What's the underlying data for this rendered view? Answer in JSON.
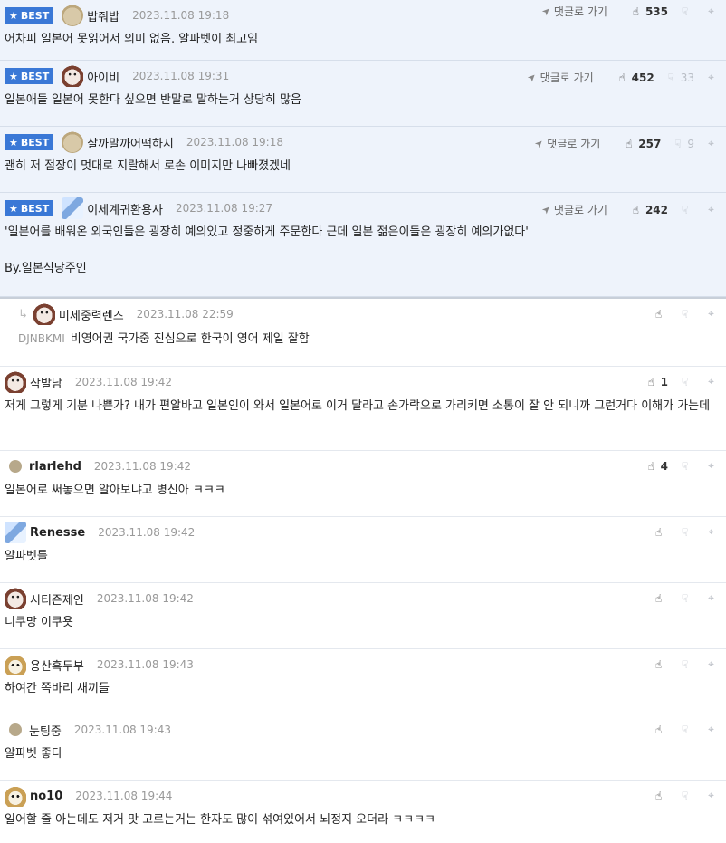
{
  "ui": {
    "best_label": "BEST",
    "goto_label": "댓글로 가기"
  },
  "comments": [
    {
      "best": true,
      "avatar": "blob-avatar",
      "nickname": "밥줘밥",
      "date": "2023.11.08 19:18",
      "likes": "535",
      "dislikes": "",
      "show_goto": true,
      "body": "어차피 일본어 못읽어서 의미 없음. 알파벳이 최고임"
    },
    {
      "best": true,
      "avatar": "dog-avatar",
      "nickname": "아이비",
      "date": "2023.11.08 19:31",
      "likes": "452",
      "dislikes": "33",
      "show_goto": true,
      "body": "일본애들 일본어 못한다 싶으면 반말로 말하는거 상당히 많음"
    },
    {
      "best": true,
      "avatar": "blob-avatar",
      "nickname": "살까말까어떡하지",
      "date": "2023.11.08 19:18",
      "likes": "257",
      "dislikes": "9",
      "show_goto": true,
      "body": "괜히 저 점장이 멋대로 지랄해서 로손 이미지만 나빠졌겠네"
    },
    {
      "best": true,
      "avatar": "crystal-avatar",
      "nickname": "이세계귀환용사",
      "date": "2023.11.08 19:27",
      "likes": "242",
      "dislikes": "",
      "show_goto": true,
      "body": "'일본어를 배워온 외국인들은 굉장히 예의있고 정중하게 주문한다 근데 일본 젊은이들은 굉장히 예의가없다'\n\nBy.일본식당주인"
    },
    {
      "best": false,
      "reply": true,
      "avatar": "dog-avatar",
      "nickname": "미세중력렌즈",
      "date": "2023.11.08 22:59",
      "likes": "",
      "dislikes": "",
      "show_goto": false,
      "reply_to": "DJNBKMI",
      "body": "비영어권 국가중 진심으로 한국이 영어 제일 잘함"
    },
    {
      "best": false,
      "avatar": "dog-avatar",
      "nickname": "삭발남",
      "date": "2023.11.08 19:42",
      "likes": "1",
      "dislikes": "",
      "show_goto": false,
      "body": "저게 그렇게 기분 나쁜가? 내가 편알바고 일본인이 와서 일본어로 이거 달라고 손가락으로 가리키면 소통이 잘 안 되니까 그런거다 이해가 가는데"
    },
    {
      "best": false,
      "avatar": "dot-avatar",
      "nickname": "rlarlehd",
      "date": "2023.11.08 19:42",
      "likes": "4",
      "dislikes": "",
      "show_goto": false,
      "body": "일본어로 써놓으면 알아보냐고 병신아 ㅋㅋㅋ"
    },
    {
      "best": false,
      "avatar": "crystal-avatar",
      "nickname": "Renesse",
      "date": "2023.11.08 19:42",
      "likes": "",
      "dislikes": "",
      "show_goto": false,
      "body": "알파벳를"
    },
    {
      "best": false,
      "avatar": "dog-avatar",
      "nickname": "시티즌제인",
      "date": "2023.11.08 19:42",
      "likes": "",
      "dislikes": "",
      "show_goto": false,
      "body": "니쿠망 이쿠욧"
    },
    {
      "best": false,
      "avatar": "fox-avatar",
      "nickname": "용산흑두부",
      "date": "2023.11.08 19:43",
      "likes": "",
      "dislikes": "",
      "show_goto": false,
      "body": "하여간 쪽바리 새끼들"
    },
    {
      "best": false,
      "avatar": "dot-avatar",
      "nickname": "눈팅중",
      "date": "2023.11.08 19:43",
      "likes": "",
      "dislikes": "",
      "show_goto": false,
      "body": "알파벳 좋다"
    },
    {
      "best": false,
      "avatar": "fox-avatar",
      "nickname": "no10",
      "date": "2023.11.08 19:44",
      "likes": "",
      "dislikes": "",
      "show_goto": false,
      "body": "일어할 줄 아는데도 저거 맛 고르는거는 한자도 많이 섞여있어서 뇌정지 오더라 ㅋㅋㅋㅋ"
    }
  ]
}
